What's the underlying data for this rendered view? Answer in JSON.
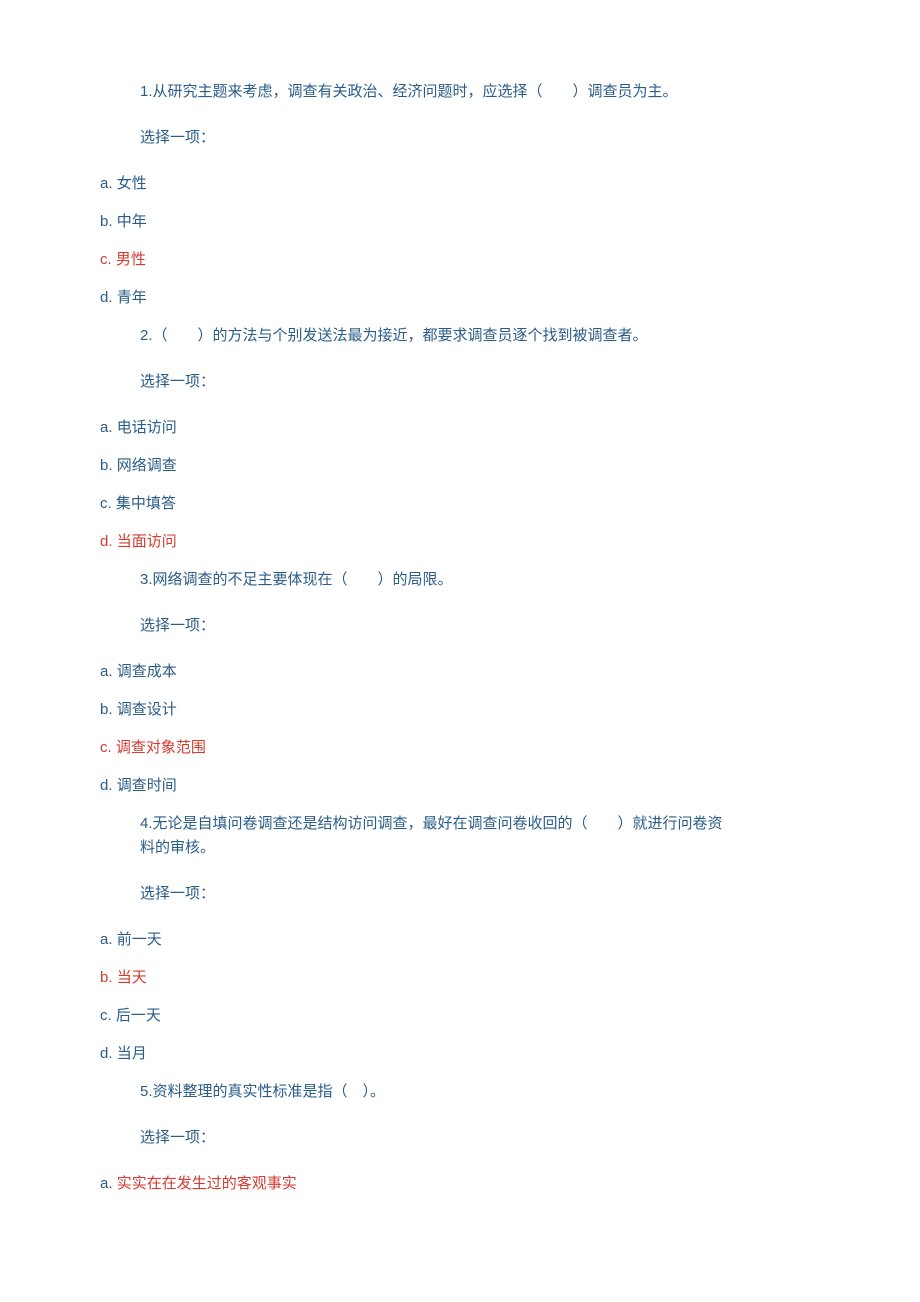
{
  "questions": [
    {
      "text": "1.从研究主题来考虑，调查有关政治、经济问题时，应选择（　　）调查员为主。",
      "choose": "选择一项：",
      "options": [
        {
          "prefix": "a. ",
          "label": "女性",
          "correct": false
        },
        {
          "prefix": "b. ",
          "label": "中年",
          "correct": false
        },
        {
          "prefix": "c. ",
          "label": "男性",
          "correct": true
        },
        {
          "prefix": "d. ",
          "label": "青年",
          "correct": false
        }
      ]
    },
    {
      "text": "2.（　　）的方法与个别发送法最为接近，都要求调查员逐个找到被调查者。",
      "choose": "选择一项：",
      "options": [
        {
          "prefix": "a. ",
          "label": "电话访问",
          "correct": false
        },
        {
          "prefix": "b. ",
          "label": "网络调查",
          "correct": false
        },
        {
          "prefix": "c. ",
          "label": "集中填答",
          "correct": false
        },
        {
          "prefix": "d. ",
          "label": "当面访问",
          "correct": true
        }
      ]
    },
    {
      "text": "3.网络调查的不足主要体现在（　　）的局限。",
      "choose": "选择一项：",
      "options": [
        {
          "prefix": "a. ",
          "label": "调查成本",
          "correct": false
        },
        {
          "prefix": "b. ",
          "label": "调查设计",
          "correct": false
        },
        {
          "prefix": "c. ",
          "label": "调查对象范围",
          "correct": true
        },
        {
          "prefix": "d. ",
          "label": "调查时间",
          "correct": false
        }
      ]
    },
    {
      "text_line1": "4.无论是自填问卷调查还是结构访问调查，最好在调查问卷收回的（　　）就进行问卷资",
      "text_line2": "料的审核。",
      "choose": "选择一项：",
      "options": [
        {
          "prefix": "a. ",
          "label": "前一天",
          "correct": false
        },
        {
          "prefix": "b. ",
          "label": "当天",
          "correct": true
        },
        {
          "prefix": "c. ",
          "label": "后一天",
          "correct": false
        },
        {
          "prefix": "d. ",
          "label": "当月",
          "correct": false
        }
      ]
    },
    {
      "text": "5.资料整理的真实性标准是指（　）。",
      "choose": "选择一项：",
      "options": [
        {
          "prefix": "a. ",
          "label": "实实在在发生过的客观事实",
          "correct": true
        }
      ]
    }
  ]
}
